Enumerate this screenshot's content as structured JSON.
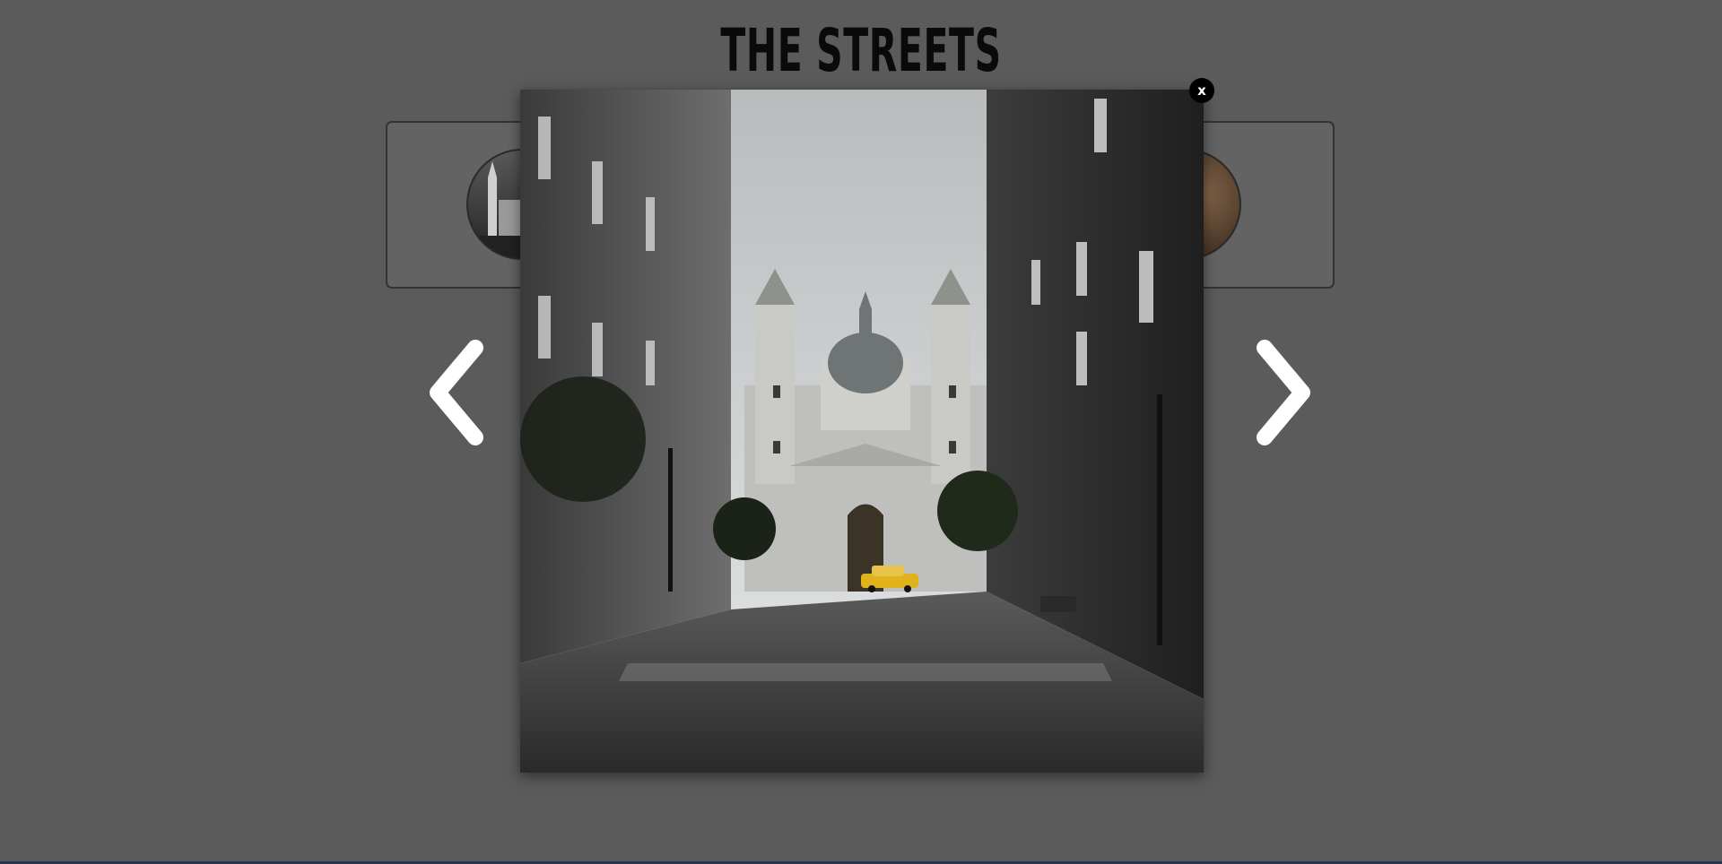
{
  "gallery": {
    "title": "THE STREETS"
  },
  "lightbox": {
    "close_label": "x",
    "image_name": "street-cathedral-photo"
  },
  "navigation": {
    "prev_icon": "chevron-left-icon",
    "next_icon": "chevron-right-icon"
  },
  "colors": {
    "background": "#5b5b5b",
    "title": "#0a0a0a",
    "close_button": "#000000",
    "arrow": "#ffffff",
    "taxi": "#e0b21c"
  }
}
